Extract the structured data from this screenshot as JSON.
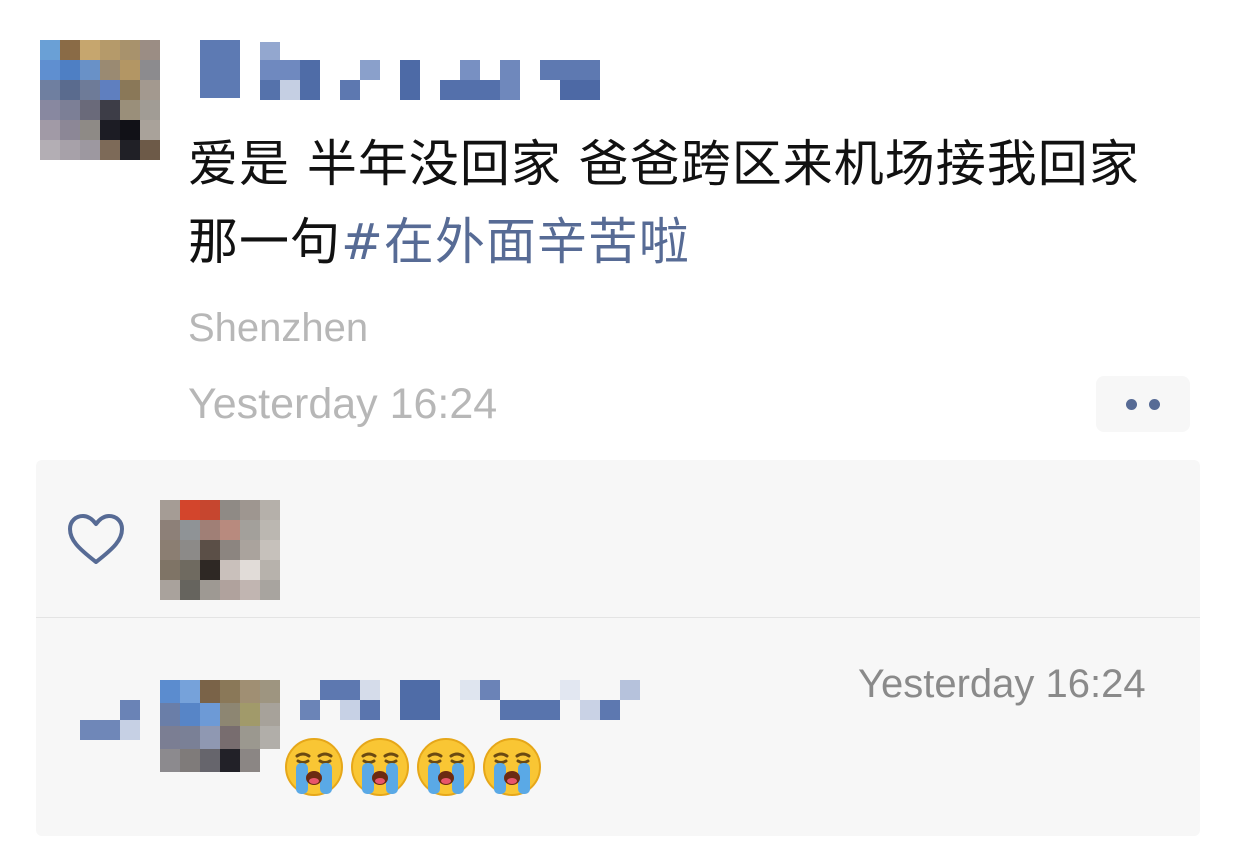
{
  "post": {
    "text": "爱是 半年没回家 爸爸跨区来机场接我回家 那一句",
    "hashtag": "#在外面辛苦啦",
    "location": "Shenzhen",
    "timestamp": "Yesterday 16:24"
  },
  "comment": {
    "timestamp": "Yesterday 16:24",
    "emoji_count": 4,
    "emoji_name": "loudly-crying-face"
  },
  "colors": {
    "link": "#576b95",
    "meta_gray": "#b7b7b7",
    "panel_bg": "#f7f7f7"
  }
}
